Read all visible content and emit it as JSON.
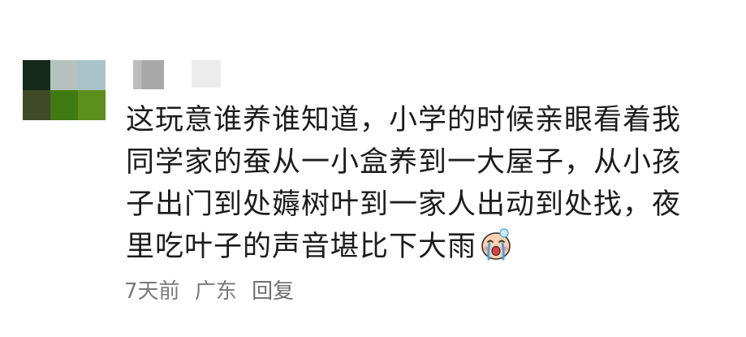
{
  "comment": {
    "avatar_pixels": [
      "#15291d",
      "#b5c2bd",
      "#a8c3c9",
      "#404a28",
      "#3f7a12",
      "#5d8f1c"
    ],
    "username_obscured": true,
    "lines": [
      "这玩意谁养谁知道，小学的时候亲眼看着我",
      "同学家的蚕从一小盒养到一大屋子，从小孩",
      "子出门到处薅树叶到一家人出动到处找，夜",
      "里吃叶子的声音堪比下大雨"
    ],
    "emoji": "crying-face-icon",
    "time": "7天前",
    "location": "广东",
    "reply_label": "回复"
  }
}
